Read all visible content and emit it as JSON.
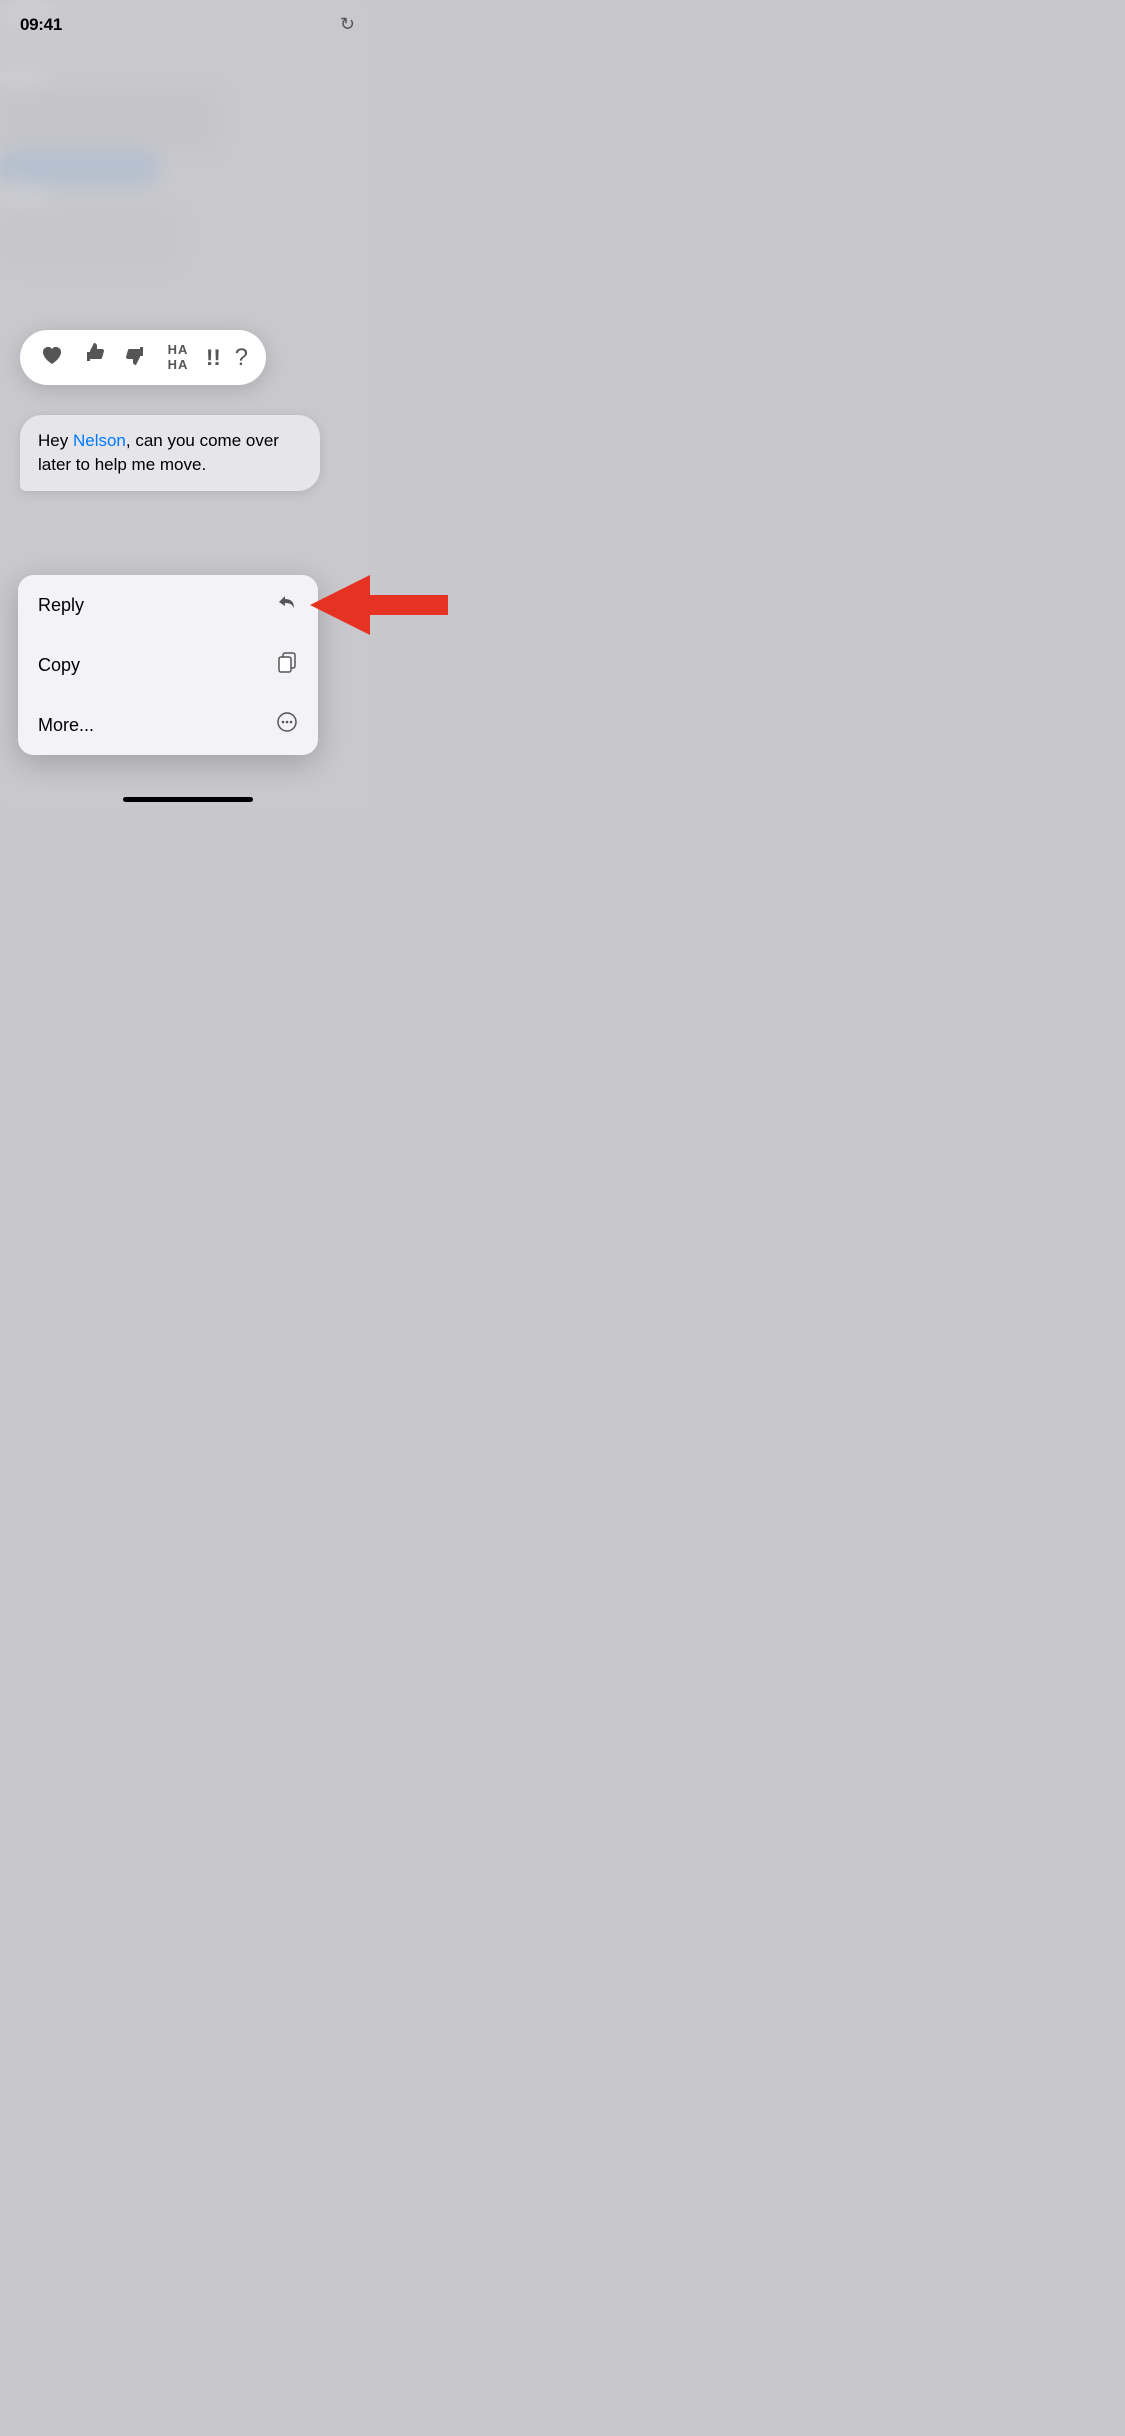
{
  "statusBar": {
    "time": "09:41",
    "refreshIconLabel": "↻"
  },
  "reactions": {
    "items": [
      {
        "id": "heart",
        "emoji": "♥",
        "label": "Heart"
      },
      {
        "id": "thumbsup",
        "emoji": "👍",
        "label": "Like"
      },
      {
        "id": "thumbsdown",
        "emoji": "👎",
        "label": "Dislike"
      },
      {
        "id": "haha",
        "emoji": "HA\nHA",
        "label": "Haha"
      },
      {
        "id": "emphasis",
        "emoji": "!!",
        "label": "Emphasis"
      },
      {
        "id": "question",
        "emoji": "?",
        "label": "Question"
      }
    ]
  },
  "message": {
    "text_prefix": "Hey ",
    "mention": "Nelson",
    "text_suffix": ", can you come over later to help me move.",
    "full_text": "Hey Nelson, can you come over later to help me move."
  },
  "contextMenu": {
    "items": [
      {
        "id": "reply",
        "label": "Reply",
        "iconType": "reply"
      },
      {
        "id": "copy",
        "label": "Copy",
        "iconType": "copy"
      },
      {
        "id": "more",
        "label": "More...",
        "iconType": "more"
      }
    ]
  },
  "colors": {
    "accent": "#007aff",
    "arrowColor": "#e63222",
    "bubbleBg": "#e5e5ea",
    "menuBg": "#f2f2f7"
  }
}
